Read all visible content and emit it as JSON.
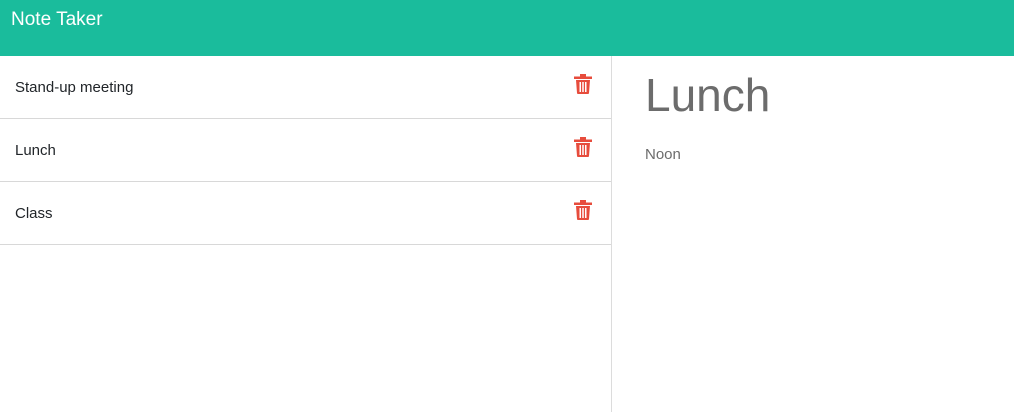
{
  "navbar": {
    "brand": "Note Taker"
  },
  "notes": [
    {
      "title": "Stand-up meeting"
    },
    {
      "title": "Lunch"
    },
    {
      "title": "Class"
    }
  ],
  "active_note": {
    "title": "Lunch",
    "text": "Noon"
  },
  "colors": {
    "navbar_bg": "#1abc9c",
    "delete_icon": "#e74c3c"
  },
  "icons": {
    "delete": "trash-icon"
  }
}
